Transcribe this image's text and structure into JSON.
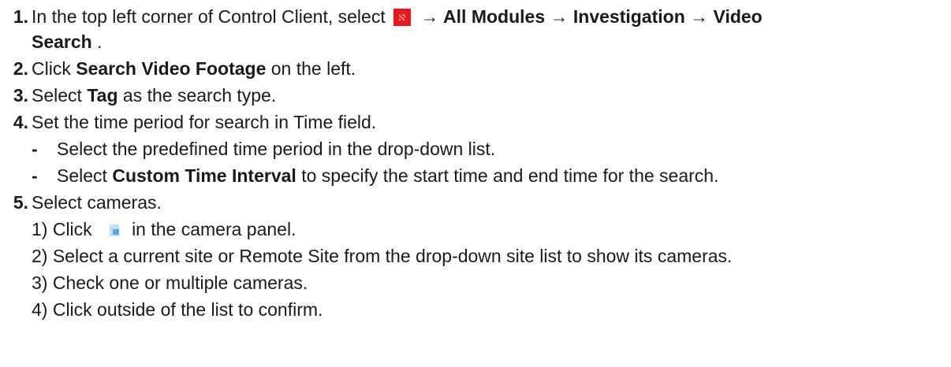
{
  "steps": [
    {
      "num": "1.",
      "a": "In the top left corner of Control Client, select ",
      "icon": "menu-icon",
      "b": " → All Modules → Investigation → Video",
      "c": "Search",
      "d": " ."
    },
    {
      "num": "2.",
      "a": "Click ",
      "bold": "Search Video Footage",
      "c": " on the left."
    },
    {
      "num": "3.",
      "a": "Select ",
      "bold": "Tag",
      "c": " as the search type."
    },
    {
      "num": "4.",
      "a": "Set the time period for search in Time field.",
      "sub": [
        {
          "dash": "-",
          "a": "Select the predefined time period in the drop-down list."
        },
        {
          "dash": "-",
          "a": "Select ",
          "bold": "Custom Time Interval",
          "c": " to specify the start time and end time for the search."
        }
      ]
    },
    {
      "num": "5.",
      "a": "Select cameras.",
      "sub": [
        {
          "a": "1) Click ",
          "icon": "camera-add-icon",
          "c": "in the camera panel."
        },
        {
          "a": "2) Select a current site or Remote Site from the drop-down site list to show its cameras."
        },
        {
          "a": "3) Check one or multiple cameras."
        },
        {
          "a": "4) Click outside of the list to confirm."
        }
      ]
    }
  ],
  "colors": {
    "text": "#1a1a1a",
    "menu_icon": "#e8191e",
    "camera_icon": "#5aa5d9"
  }
}
